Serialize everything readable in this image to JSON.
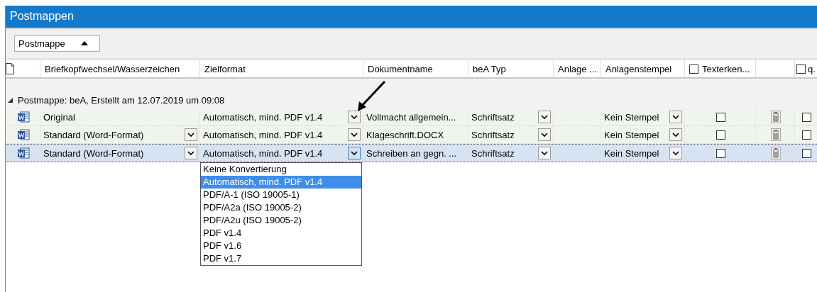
{
  "window": {
    "title": "Postmappen"
  },
  "toolbar": {
    "sort_button": {
      "label": "Postmappe",
      "ascending": true
    }
  },
  "table": {
    "columns": [
      {
        "kind": "icon"
      },
      {
        "kind": "text",
        "label": "Briefkopfwechsel/Wasserzeichen"
      },
      {
        "kind": "text",
        "label": "Zielformat"
      },
      {
        "kind": "text",
        "label": "Dokumentname"
      },
      {
        "kind": "text",
        "label": "beA Typ"
      },
      {
        "kind": "text",
        "label": "Anlage ..."
      },
      {
        "kind": "text",
        "label": "Anlagenstempel"
      },
      {
        "kind": "checkbox",
        "label": "Texterken...",
        "checked": false
      },
      {
        "kind": "blank"
      },
      {
        "kind": "checkbox",
        "label": "q.",
        "checked": false
      }
    ],
    "group": {
      "label": "Postmappe: beA, Erstellt am 12.07.2019 um 09:08",
      "expanded": true
    },
    "rows": [
      {
        "selected": false,
        "briefkopf": {
          "value": "Original",
          "has_dropdown": false
        },
        "zielformat": {
          "value": "Automatisch, mind. PDF v1.4",
          "open": false
        },
        "dokumentname": "Vollmacht allgemein...",
        "bea_typ": "Schriftsatz",
        "anlagenstempel": "Kein Stempel",
        "texterkennung": false,
        "column_10": false
      },
      {
        "selected": false,
        "briefkopf": {
          "value": "Standard (Word-Format)",
          "has_dropdown": true
        },
        "zielformat": {
          "value": "Automatisch, mind. PDF v1.4",
          "open": false
        },
        "dokumentname": "Klageschrift.DOCX",
        "bea_typ": "Schriftsatz",
        "anlagenstempel": "Kein Stempel",
        "texterkennung": false,
        "column_10": false
      },
      {
        "selected": true,
        "briefkopf": {
          "value": "Standard (Word-Format)",
          "has_dropdown": true
        },
        "zielformat": {
          "value": "Automatisch, mind. PDF v1.4",
          "open": true
        },
        "dokumentname": "Schreiben an gegn. ...",
        "bea_typ": "Schriftsatz",
        "anlagenstempel": "Kein Stempel",
        "texterkennung": false,
        "column_10": false
      }
    ],
    "zielformat_options": [
      {
        "label": "Keine Konvertierung",
        "selected": false
      },
      {
        "label": "Automatisch, mind. PDF v1.4",
        "selected": true
      },
      {
        "label": "PDF/A-1 (ISO 19005-1)",
        "selected": false
      },
      {
        "label": "PDF/A2a (ISO 19005-2)",
        "selected": false
      },
      {
        "label": "PDF/A2u (ISO 19005-2)",
        "selected": false
      },
      {
        "label": "PDF v1.4",
        "selected": false
      },
      {
        "label": "PDF v1.6",
        "selected": false
      },
      {
        "label": "PDF v1.7",
        "selected": false
      }
    ]
  }
}
